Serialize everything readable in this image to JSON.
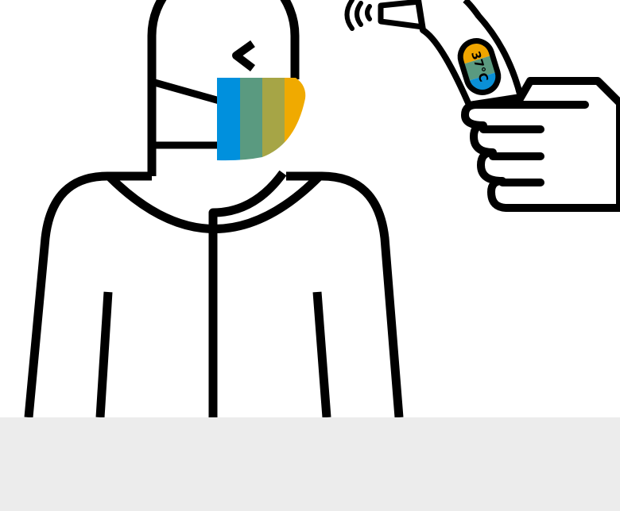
{
  "thermometer": {
    "reading": "37°C",
    "display_colors": [
      "#f0a500",
      "#5a9a80",
      "#0a8fd6"
    ]
  },
  "mask": {
    "stripe_colors": [
      "#0090dd",
      "#5a9a80",
      "#a6a546",
      "#f0aa00"
    ]
  },
  "colors": {
    "line": "#000000",
    "background": "#ffffff",
    "footer_band": "#ececec"
  },
  "icons": {
    "person": "person-in-protective-suit-icon",
    "thermometer": "infrared-thermometer-icon",
    "hand": "hand-icon",
    "signal": "signal-waves-icon"
  }
}
